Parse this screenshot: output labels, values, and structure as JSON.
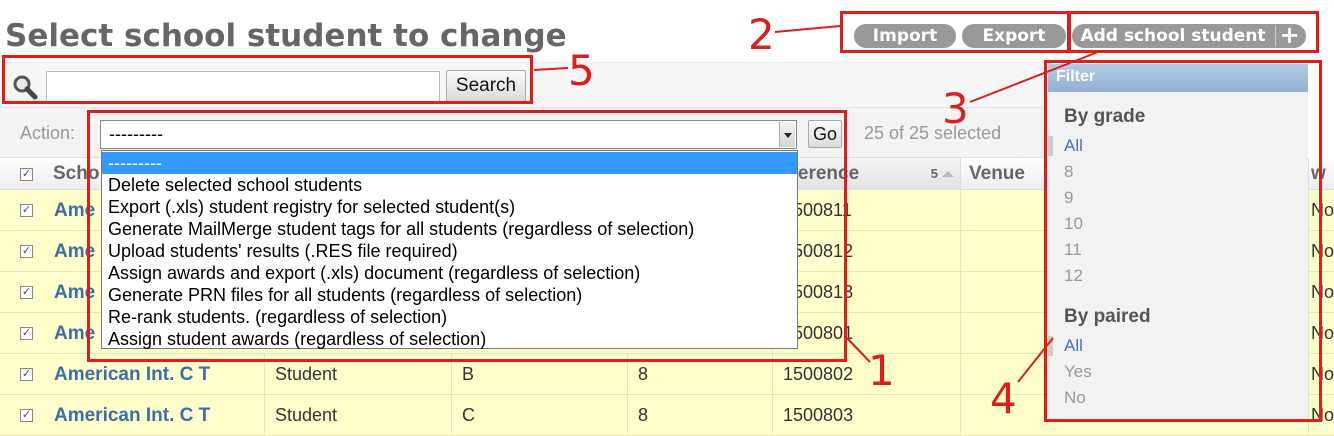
{
  "page": {
    "title": "Select school student to change"
  },
  "toolbar": {
    "import_label": "Import",
    "export_label": "Export",
    "add_label": "Add school student",
    "add_icon": "plus-icon"
  },
  "search": {
    "value": "",
    "placeholder": "",
    "button_label": "Search",
    "icon": "magnifier-icon"
  },
  "actions": {
    "label": "Action:",
    "selected_value": "---------",
    "go_label": "Go",
    "count_text": "25 of 25 selected",
    "options": [
      "---------",
      "Delete selected school students",
      "Export (.xls) student registry for selected student(s)",
      "Generate MailMerge student tags for all students (regardless of selection)",
      "Upload students' results (.RES file required)",
      "Assign awards and export (.xls) document (regardless of selection)",
      "Generate PRN files for all students (regardless of selection)",
      "Re-rank students. (regardless of selection)",
      "Assign student awards (regardless of selection)"
    ]
  },
  "table": {
    "headers": {
      "school": "Scho",
      "reference": "eference",
      "reference_sort_index": "5",
      "venue": "Venue",
      "last": "w"
    },
    "rows": [
      {
        "name": "Ame",
        "type": "",
        "class": "",
        "grade": "",
        "reference": "1500811",
        "last": "No"
      },
      {
        "name": "Ame",
        "type": "",
        "class": "",
        "grade": "",
        "reference": "1500812",
        "last": "No"
      },
      {
        "name": "Ame",
        "type": "",
        "class": "",
        "grade": "",
        "reference": "1500813",
        "last": "No"
      },
      {
        "name": "Ame",
        "type": "",
        "class": "",
        "grade": "",
        "reference": "1500801",
        "last": "No"
      },
      {
        "name": "American Int. C T",
        "type": "Student",
        "class": "B",
        "grade": "8",
        "reference": "1500802",
        "last": "No"
      },
      {
        "name": "American Int. C T",
        "type": "Student",
        "class": "C",
        "grade": "8",
        "reference": "1500803",
        "last": "No"
      }
    ]
  },
  "filter": {
    "title": "Filter",
    "groups": [
      {
        "title": "By grade",
        "options": [
          "All",
          "8",
          "9",
          "10",
          "11",
          "12"
        ],
        "active": "All"
      },
      {
        "title": "By paired",
        "options": [
          "All",
          "Yes",
          "No"
        ],
        "active": "All"
      }
    ]
  },
  "annotations": {
    "n1": "1",
    "n2": "2",
    "n3": "3",
    "n4": "4",
    "n5": "5",
    "color": "#e21b1b"
  },
  "colors": {
    "row_bg": "#ffffcc",
    "link": "#3d6ea9",
    "filter_header": "#9fb9d8",
    "button_bg": "#999999",
    "select_highlight": "#3399ff"
  }
}
